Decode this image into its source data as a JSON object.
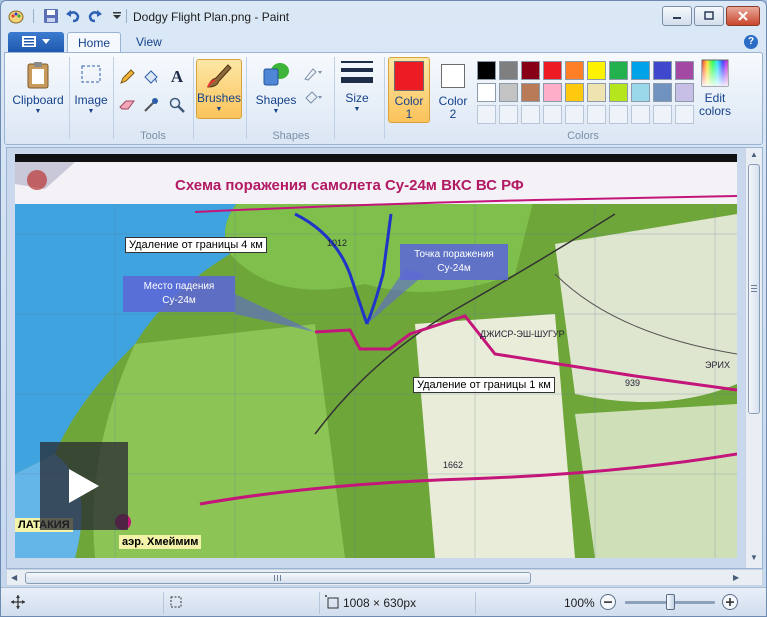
{
  "window": {
    "title": "Dodgy Flight Plan.png - Paint"
  },
  "tabs": [
    {
      "label": "Home",
      "active": true
    },
    {
      "label": "View",
      "active": false
    }
  ],
  "ribbon": {
    "clipboard_label": "Clipboard",
    "image_label": "Image",
    "tools_group": "Tools",
    "brushes_label": "Brushes",
    "shapes_label": "Shapes",
    "shapes_group": "Shapes",
    "size_label": "Size",
    "color1_label": "Color\n1",
    "color1_line1": "Color",
    "color1_line2": "1",
    "color2_line1": "Color",
    "color2_line2": "2",
    "colors_group": "Colors",
    "edit_colors_line1": "Edit",
    "edit_colors_line2": "colors",
    "color1_value": "#ed1c24",
    "color2_value": "#ffffff",
    "palette": [
      "#000000",
      "#7f7f7f",
      "#880015",
      "#ed1c24",
      "#ff7f27",
      "#fff200",
      "#22b14c",
      "#00a2e8",
      "#3f48cc",
      "#a349a4",
      "#ffffff",
      "#c3c3c3",
      "#b97a57",
      "#ffaec9",
      "#ffc90e",
      "#efe4b0",
      "#b5e61d",
      "#99d9ea",
      "#7092be",
      "#c8bfe7"
    ]
  },
  "image": {
    "heading": "Схема поражения самолета Су-24м ВКС ВС РФ",
    "label_border_4km": "Удаление от границы 4 км",
    "label_border_1km": "Удаление от границы 1 км",
    "callout_crash_line1": "Место падения",
    "callout_crash_line2": "Су-24м",
    "callout_hit_line1": "Точка поражения",
    "callout_hit_line2": "Су-24м",
    "label_latakia": "ЛАТАКИЯ",
    "label_airbase": "аэр. Хмеймим",
    "label_height": "1662",
    "label_town": "ДЖИСР-ЭШ-ШУГУР",
    "label_erikh": "ЭРИХ",
    "label_939": "939",
    "label_1012": "1012"
  },
  "statusbar": {
    "dimensions": "1008 × 630px",
    "zoom": "100%",
    "zoom_level": 1.0
  }
}
